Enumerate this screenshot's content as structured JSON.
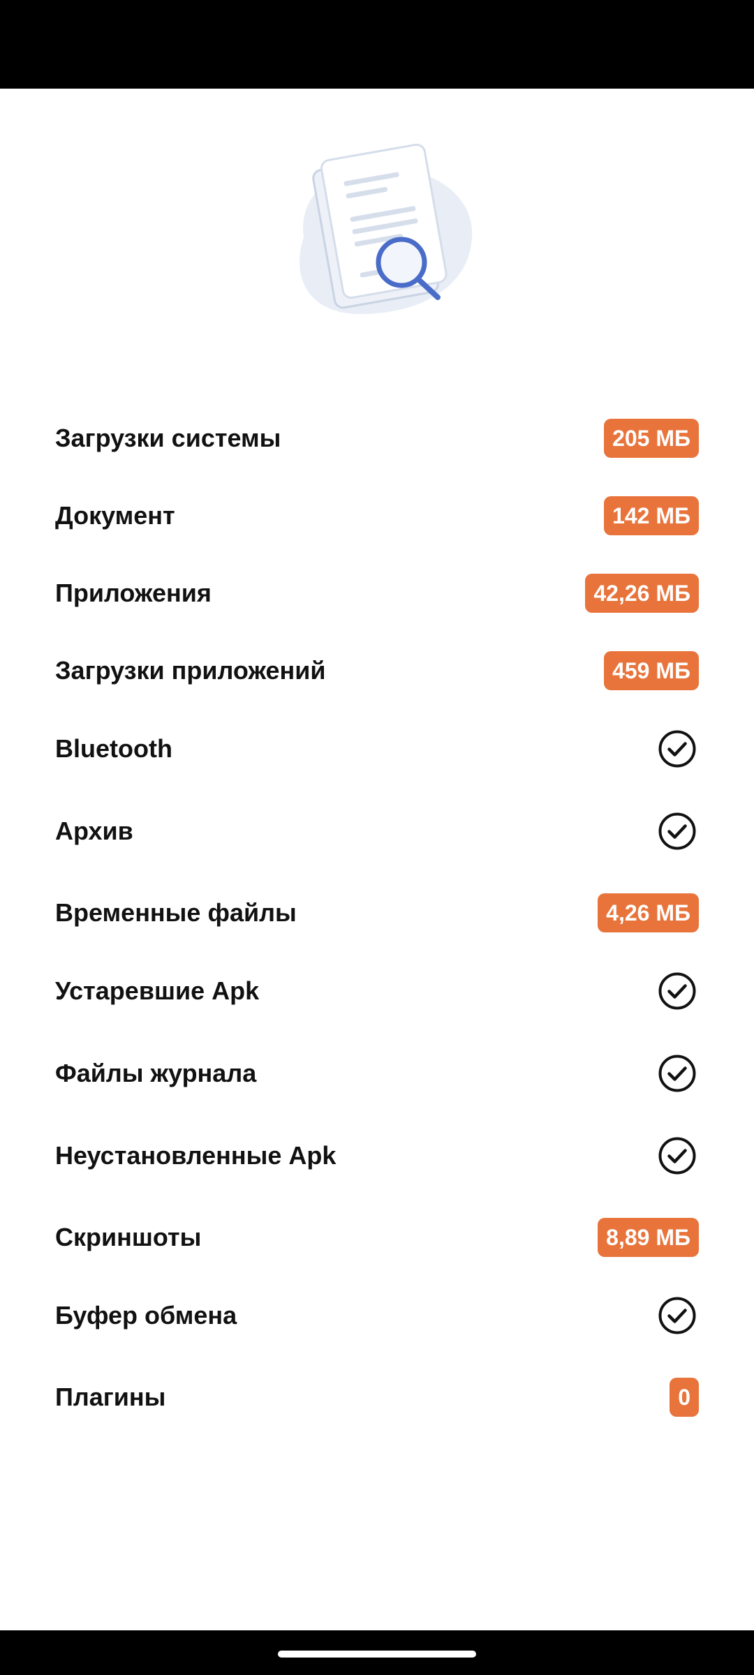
{
  "colors": {
    "badge": "#E8743B",
    "text": "#111111",
    "background": "#FFFFFF",
    "illustration_accent": "#4A6CC9"
  },
  "header": {
    "illustration_icon": "document-search-icon"
  },
  "items": [
    {
      "label": "Загрузки системы",
      "value": "205 МБ",
      "status": "size"
    },
    {
      "label": "Документ",
      "value": "142 МБ",
      "status": "size"
    },
    {
      "label": "Приложения",
      "value": "42,26 МБ",
      "status": "size"
    },
    {
      "label": "Загрузки приложений",
      "value": "459 МБ",
      "status": "size"
    },
    {
      "label": "Bluetooth",
      "status": "checked",
      "icon": "check-circle-icon"
    },
    {
      "label": "Архив",
      "status": "checked",
      "icon": "check-circle-icon"
    },
    {
      "label": "Временные файлы",
      "value": "4,26 МБ",
      "status": "size"
    },
    {
      "label": "Устаревшие Apk",
      "status": "checked",
      "icon": "check-circle-icon"
    },
    {
      "label": "Файлы журнала",
      "status": "checked",
      "icon": "check-circle-icon"
    },
    {
      "label": "Неустановленные Apk",
      "status": "checked",
      "icon": "check-circle-icon"
    },
    {
      "label": "Скриншоты",
      "value": "8,89 МБ",
      "status": "size"
    },
    {
      "label": "Буфер обмена",
      "status": "checked",
      "icon": "check-circle-icon"
    },
    {
      "label": "Плагины",
      "value": "0",
      "status": "size"
    }
  ]
}
